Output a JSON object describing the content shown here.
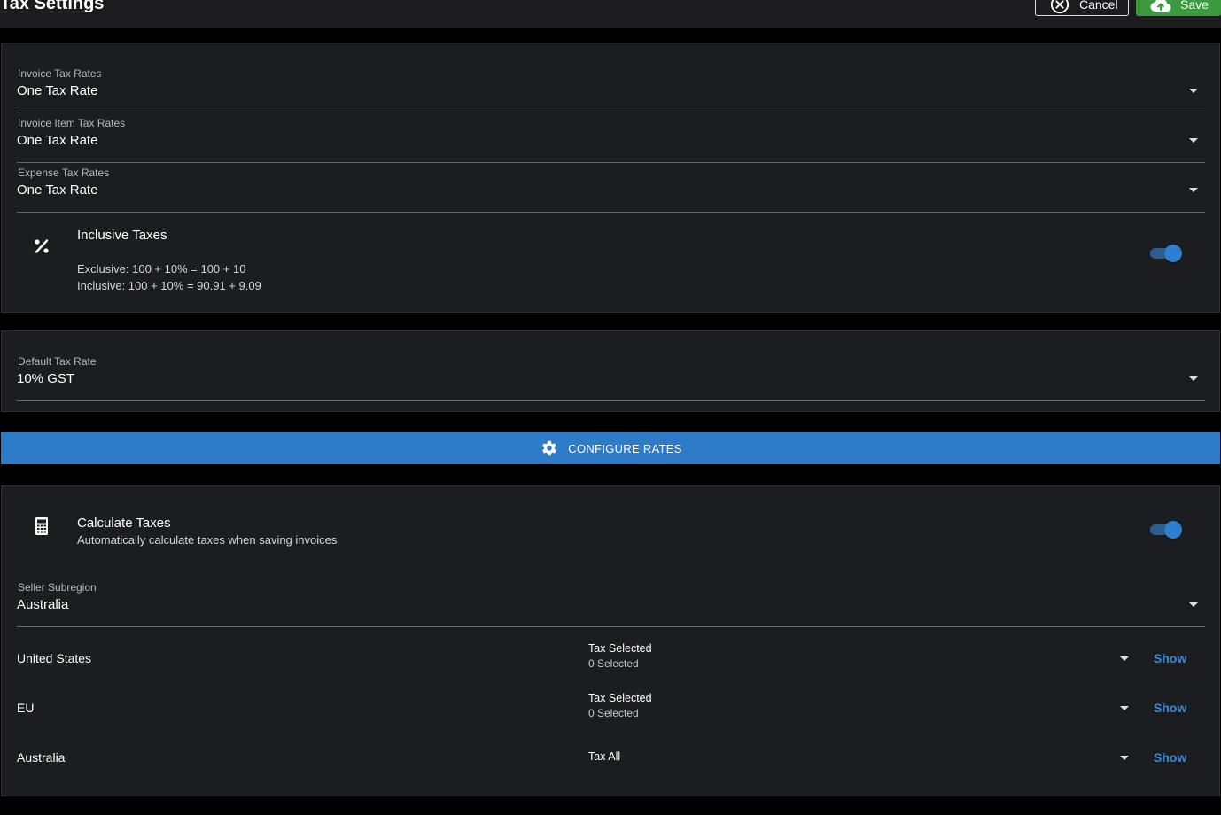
{
  "header": {
    "title": "Tax Settings",
    "cancel_label": "Cancel",
    "save_label": "Save"
  },
  "tax_rates": {
    "invoice": {
      "label": "Invoice Tax Rates",
      "value": "One Tax Rate"
    },
    "invoice_item": {
      "label": "Invoice Item Tax Rates",
      "value": "One Tax Rate"
    },
    "expense": {
      "label": "Expense Tax Rates",
      "value": "One Tax Rate"
    }
  },
  "inclusive_taxes": {
    "icon": "percent-icon",
    "title": "Inclusive Taxes",
    "exclusive_example": "Exclusive: 100 + 10% = 100 + 10",
    "inclusive_example": "Inclusive: 100 + 10% = 90.91 + 9.09",
    "enabled": true
  },
  "default_tax": {
    "label": "Default Tax Rate",
    "value": "10% GST"
  },
  "configure_rates": {
    "icon": "gear-icon",
    "label": "CONFIGURE RATES"
  },
  "calculate_taxes": {
    "icon": "calculator-icon",
    "title": "Calculate Taxes",
    "subtitle": "Automatically calculate taxes when saving invoices",
    "enabled": true
  },
  "seller_subregion": {
    "label": "Seller Subregion",
    "value": "Australia"
  },
  "regions": [
    {
      "name": "United States",
      "select_label": "Tax Selected",
      "select_value": "0 Selected",
      "link": "Show"
    },
    {
      "name": "EU",
      "select_label": "Tax Selected",
      "select_value": "0 Selected",
      "link": "Show"
    },
    {
      "name": "Australia",
      "select_label": "Tax All",
      "select_value": "",
      "link": "Show"
    }
  ],
  "colors": {
    "background": "#000000",
    "card": "#1c1d20",
    "accent": "#2e7bc7",
    "save": "#3a9a3d",
    "link": "#3a88d8"
  }
}
